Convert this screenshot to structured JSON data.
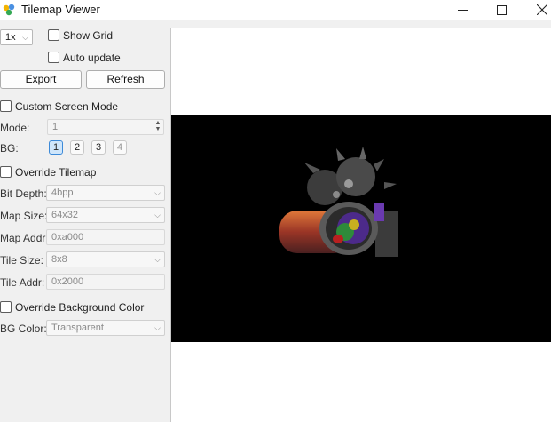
{
  "window": {
    "title": "Tilemap Viewer",
    "minimize_icon": "minimize-icon",
    "maximize_icon": "maximize-icon",
    "close_icon": "close-icon"
  },
  "sidebar": {
    "zoom": {
      "value": "1x"
    },
    "show_grid": {
      "label": "Show Grid",
      "checked": false
    },
    "auto_update": {
      "label": "Auto update",
      "checked": false
    },
    "export_label": "Export",
    "refresh_label": "Refresh",
    "custom_screen_mode": {
      "label": "Custom Screen Mode",
      "checked": false
    },
    "mode": {
      "label": "Mode:",
      "value": "1"
    },
    "bg": {
      "label": "BG:",
      "buttons": [
        "1",
        "2",
        "3",
        "4"
      ],
      "selected": "1"
    },
    "override_tilemap": {
      "label": "Override Tilemap",
      "checked": false
    },
    "bit_depth": {
      "label": "Bit Depth:",
      "value": "4bpp"
    },
    "map_size": {
      "label": "Map Size:",
      "value": "64x32"
    },
    "map_addr": {
      "label": "Map Addr:",
      "value": "0xa000"
    },
    "tile_size": {
      "label": "Tile Size:",
      "value": "8x8"
    },
    "tile_addr": {
      "label": "Tile Addr:",
      "value": "0x2000"
    },
    "override_bg_color": {
      "label": "Override Background Color",
      "checked": false
    },
    "bg_color": {
      "label": "BG Color:",
      "value": "Transparent"
    }
  },
  "colors": {
    "selected_bg_button": "#cfe6fb",
    "tilemap_background": "#000000"
  }
}
